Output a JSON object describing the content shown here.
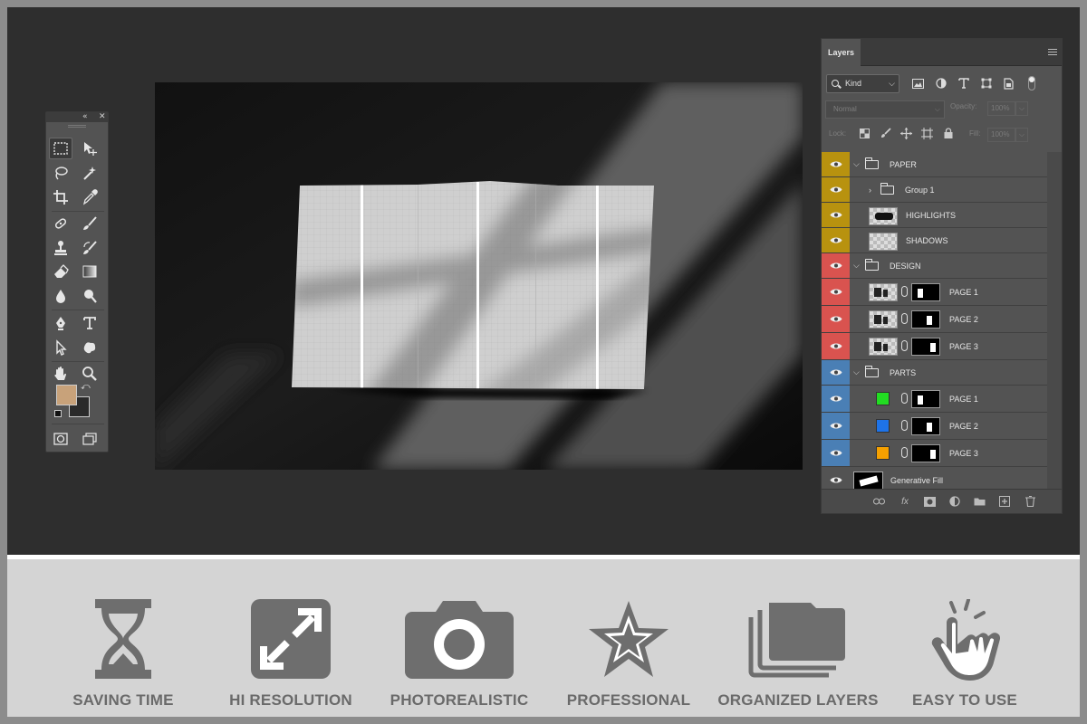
{
  "layers_panel": {
    "tab_label": "Layers",
    "kind_filter": "Kind",
    "blend_mode": "Normal",
    "opacity_label": "Opacity:",
    "opacity_value": "100%",
    "lock_label": "Lock:",
    "fill_label": "Fill:",
    "fill_value": "100%",
    "layers": [
      {
        "name": "PAPER",
        "type": "group",
        "color": "#b8920f",
        "expanded": true,
        "indent": 0
      },
      {
        "name": "Group 1",
        "type": "group",
        "color": "#b8920f",
        "expanded": false,
        "indent": 1
      },
      {
        "name": "HIGHLIGHTS",
        "type": "layer",
        "color": "#b8920f",
        "indent": 1
      },
      {
        "name": "SHADOWS",
        "type": "layer",
        "color": "#b8920f",
        "indent": 1
      },
      {
        "name": "DESIGN",
        "type": "group",
        "color": "#d9534f",
        "expanded": true,
        "indent": 0
      },
      {
        "name": "PAGE 1",
        "type": "smart-mask",
        "color": "#d9534f",
        "indent": 1
      },
      {
        "name": "PAGE 2",
        "type": "smart-mask",
        "color": "#d9534f",
        "indent": 1
      },
      {
        "name": "PAGE 3",
        "type": "smart-mask",
        "color": "#d9534f",
        "indent": 1
      },
      {
        "name": "PARTS",
        "type": "group",
        "color": "#4a7fb5",
        "expanded": true,
        "indent": 0
      },
      {
        "name": "PAGE 1",
        "type": "fill-mask",
        "color": "#4a7fb5",
        "swatch": "#22dd22",
        "indent": 1
      },
      {
        "name": "PAGE 2",
        "type": "fill-mask",
        "color": "#4a7fb5",
        "swatch": "#1e73e8",
        "indent": 1
      },
      {
        "name": "PAGE 3",
        "type": "fill-mask",
        "color": "#4a7fb5",
        "swatch": "#f5a000",
        "indent": 1
      },
      {
        "name": "Generative Fill",
        "type": "generative",
        "color": "",
        "indent": 0
      }
    ]
  },
  "tools_panel": {
    "foreground_color": "#c8a27a",
    "background_color": "#2a2a2a",
    "tools": [
      "marquee-tool",
      "move-tool",
      "lasso-tool",
      "magic-wand-tool",
      "crop-tool",
      "eyedropper-tool",
      "healing-tool",
      "brush-tool",
      "stamp-tool",
      "history-brush-tool",
      "eraser-tool",
      "gradient-tool",
      "blur-tool",
      "dodge-tool",
      "pen-tool",
      "type-tool",
      "path-selection-tool",
      "shape-tool",
      "hand-tool",
      "zoom-tool"
    ]
  },
  "features": [
    {
      "label": "SAVING TIME",
      "icon": "hourglass-icon"
    },
    {
      "label": "HI RESOLUTION",
      "icon": "expand-arrows-icon"
    },
    {
      "label": "PHOTOREALISTIC",
      "icon": "camera-icon"
    },
    {
      "label": "PROFESSIONAL",
      "icon": "star-icon"
    },
    {
      "label": "ORGANIZED LAYERS",
      "icon": "stacked-folders-icon"
    },
    {
      "label": "EASY TO USE",
      "icon": "tap-hand-icon"
    }
  ]
}
